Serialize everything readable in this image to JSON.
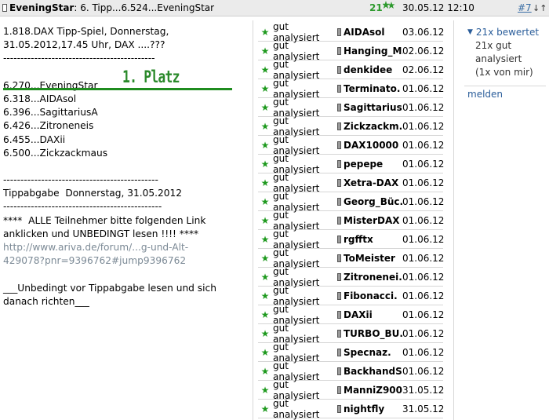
{
  "header": {
    "author": "EveningStar",
    "title": ": 6. Tipp...6.524...EveningStar",
    "score": "21",
    "date": "30.05.12 12:10",
    "post_number": "#7",
    "arrows": "↓↑"
  },
  "post": {
    "lines": [
      "1.818.DAX Tipp-Spiel, Donnerstag,",
      "31.05.2012,17.45 Uhr, DAX ....???",
      "--------------------------------------------",
      "",
      "6.270...EveningStar",
      "6.318...AIDAsol",
      "6.396...SagittariusA",
      "6.426...Zitroneneis",
      "6.455...DAXii",
      "6.500...Zickzackmaus",
      "",
      "---------------------------------------------",
      "Tippabgabe  Donnerstag, 31.05.2012",
      "----------------------------------------------",
      "****  ALLE Teilnehmer bitte folgenden Link",
      "anklicken und UNBEDINGT lesen !!!! ****",
      "http://www.ariva.de/forum/...g-und-Alt-",
      "429078?pnr=9396762#jump9396762",
      "",
      "___Unbedingt vor Tippabgabe lesen und sich",
      "danach richten___"
    ],
    "platz_label": "1. Platz"
  },
  "ratings": {
    "status_text": "gut analysiert",
    "rows": [
      {
        "user": "AIDAsol",
        "date": "03.06.12"
      },
      {
        "user": "Hanging_M.",
        "date": "02.06.12"
      },
      {
        "user": "denkidee",
        "date": "02.06.12"
      },
      {
        "user": "Terminato.",
        "date": "01.06.12"
      },
      {
        "user": "Sagittarius.",
        "date": "01.06.12"
      },
      {
        "user": "Zickzackm.",
        "date": "01.06.12"
      },
      {
        "user": "DAX10000",
        "date": "01.06.12"
      },
      {
        "user": "pepepe",
        "date": "01.06.12"
      },
      {
        "user": "Xetra-DAX",
        "date": "01.06.12"
      },
      {
        "user": "Georg_Büc.",
        "date": "01.06.12"
      },
      {
        "user": "MisterDAX",
        "date": "01.06.12"
      },
      {
        "user": "rgfftx",
        "date": "01.06.12"
      },
      {
        "user": "ToMeister",
        "date": "01.06.12"
      },
      {
        "user": "Zitronenei.",
        "date": "01.06.12"
      },
      {
        "user": "Fibonacci.",
        "date": "01.06.12"
      },
      {
        "user": "DAXii",
        "date": "01.06.12"
      },
      {
        "user": "TURBO_BU.",
        "date": "01.06.12"
      },
      {
        "user": "Specnaz.",
        "date": "01.06.12"
      },
      {
        "user": "BackhandS.",
        "date": "01.06.12"
      },
      {
        "user": "ManniZ900",
        "date": "31.05.12"
      },
      {
        "user": "nightfly",
        "date": "31.05.12"
      }
    ]
  },
  "side": {
    "rated_label": "21x bewertet",
    "detail_lines": [
      "21x gut",
      "analysiert",
      "(1x von mir)"
    ],
    "report_label": "melden"
  },
  "colors": {
    "accent_green": "#2b8a2b",
    "link_blue": "#2a5d9a"
  }
}
